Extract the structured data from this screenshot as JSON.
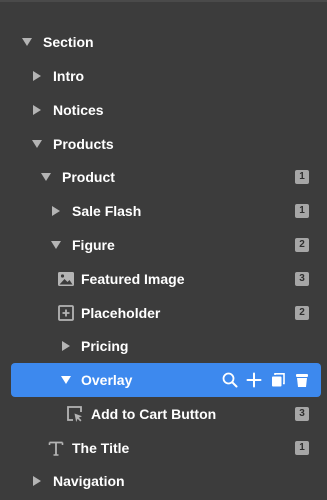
{
  "tree": {
    "section": "Section",
    "intro": "Intro",
    "notices": "Notices",
    "products": "Products",
    "product": {
      "label": "Product",
      "count": "1"
    },
    "sale_flash": {
      "label": "Sale Flash",
      "count": "1"
    },
    "figure": {
      "label": "Figure",
      "count": "2"
    },
    "featured_image": {
      "label": "Featured Image",
      "count": "3"
    },
    "placeholder": {
      "label": "Placeholder",
      "count": "2"
    },
    "pricing": "Pricing",
    "overlay": {
      "label": "Overlay"
    },
    "add_to_cart": {
      "label": "Add to Cart Button",
      "count": "3"
    },
    "the_title": {
      "label": "The Title",
      "count": "1"
    },
    "navigation": "Navigation"
  },
  "overlay_actions": [
    "search-icon",
    "add-icon",
    "duplicate-icon",
    "delete-icon"
  ],
  "colors": {
    "background": "#3c3c3c",
    "selected": "#3d89ee",
    "badge": "#a6a6a6",
    "arrow": "#b4b4b4"
  }
}
